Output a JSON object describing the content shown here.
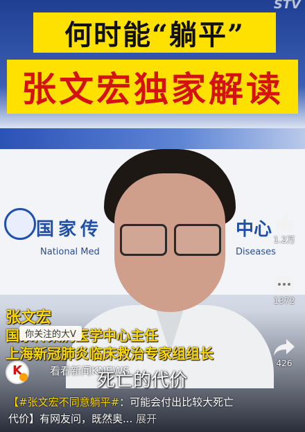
{
  "video": {
    "channel_watermark": "STV",
    "title_line1": "何时能“躺平”",
    "title_line2": "张文宏独家解读",
    "backdrop": {
      "cn_left": "国家传",
      "cn_right": "中心",
      "en_left": "National Med",
      "en_right": "Diseases"
    },
    "caption": {
      "name": "张文宏",
      "role_line1": "国家传染病医学中心主任",
      "role_line2": "上海新冠肺炎临床救治专家组组长"
    },
    "subtitle": "死亡的代价",
    "follow_badge": "你关注的大V",
    "source": {
      "avatar_letter": "K",
      "name": "看看新闻KNEWS"
    },
    "description": {
      "hashtag": "【#张文宏不同意躺平#",
      "text": "：可能会付出比较大死亡代价】有网友问，既然奥...",
      "expand": "展开"
    }
  },
  "actions": {
    "like": {
      "icon": "thumbs-up-icon",
      "count": "1.2万"
    },
    "comment": {
      "icon": "comment-icon",
      "count": "1372"
    },
    "share": {
      "icon": "share-icon",
      "count": "426"
    }
  },
  "colors": {
    "title_bg": "#ffe100",
    "title2_text": "#d41212",
    "caption_text": "#ffd800"
  }
}
